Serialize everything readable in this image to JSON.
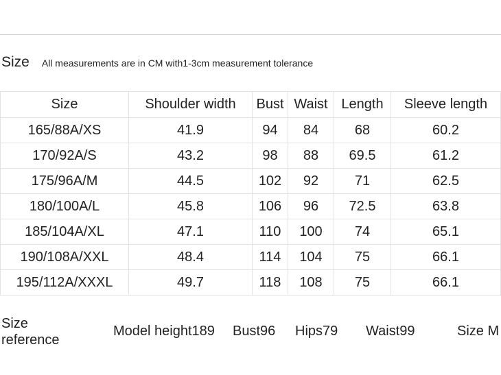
{
  "header": {
    "title": "Size",
    "note": "All measurements are in CM with1-3cm measurement tolerance"
  },
  "table": {
    "headers": [
      "Size",
      "Shoulder width",
      "Bust",
      "Waist",
      "Length",
      "Sleeve length"
    ],
    "rows": [
      [
        "165/88A/XS",
        "41.9",
        "94",
        "84",
        "68",
        "60.2"
      ],
      [
        "170/92A/S",
        "43.2",
        "98",
        "88",
        "69.5",
        "61.2"
      ],
      [
        "175/96A/M",
        "44.5",
        "102",
        "92",
        "71",
        "62.5"
      ],
      [
        "180/100A/L",
        "45.8",
        "106",
        "96",
        "72.5",
        "63.8"
      ],
      [
        "185/104A/XL",
        "47.1",
        "110",
        "100",
        "74",
        "65.1"
      ],
      [
        "190/108A/XXL",
        "48.4",
        "114",
        "104",
        "75",
        "66.1"
      ],
      [
        "195/112A/XXXL",
        "49.7",
        "118",
        "108",
        "75",
        "66.1"
      ]
    ]
  },
  "reference": {
    "label_line1": "Size",
    "label_line2": "reference",
    "model_height": "Model height189",
    "bust": "Bust96",
    "hips": "Hips79",
    "waist": "Waist99",
    "size": "Size M"
  },
  "colors": {
    "text": "#222222",
    "grid_line": "#e2e2e2",
    "top_rule": "#d4d4d4"
  }
}
